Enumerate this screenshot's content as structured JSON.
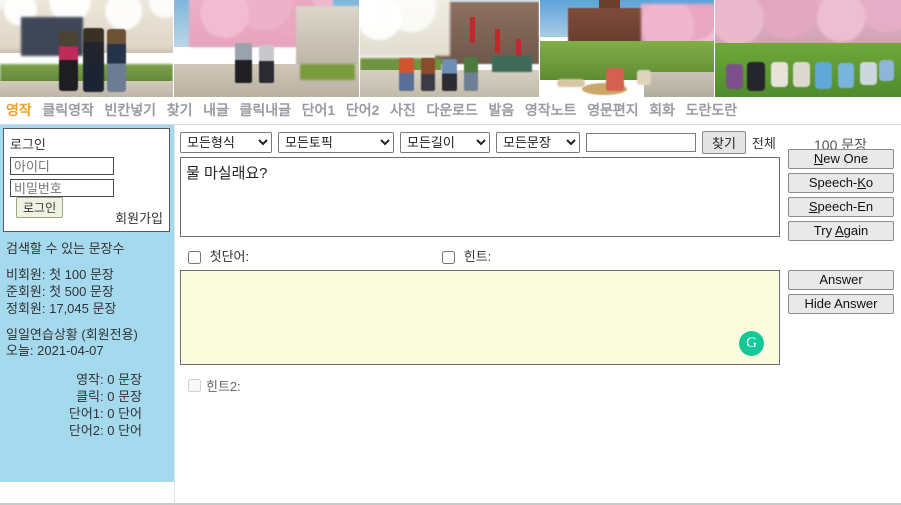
{
  "banner": {
    "alt": "campus spring photos banner",
    "panes": [
      "students-walking-blossom",
      "pink-blossom-street",
      "campus-red-banners",
      "brick-hall-lawn",
      "students-group-lawn"
    ]
  },
  "nav": {
    "items": [
      {
        "label": "영작",
        "active": true
      },
      {
        "label": "클릭영작",
        "active": false
      },
      {
        "label": "빈칸넣기",
        "active": false
      },
      {
        "label": "찾기",
        "active": false
      },
      {
        "label": "내글",
        "active": false
      },
      {
        "label": "클릭내글",
        "active": false
      },
      {
        "label": "단어1",
        "active": false
      },
      {
        "label": "단어2",
        "active": false
      },
      {
        "label": "사진",
        "active": false
      },
      {
        "label": "다운로드",
        "active": false
      },
      {
        "label": "발음",
        "active": false
      },
      {
        "label": "영작노트",
        "active": false
      },
      {
        "label": "영문편지",
        "active": false
      },
      {
        "label": "회화",
        "active": false
      },
      {
        "label": "도란도란",
        "active": false
      }
    ]
  },
  "sidebar": {
    "login": {
      "title": "로그인",
      "id_placeholder": "아이디",
      "pw_placeholder": "비밀번호",
      "login_button": "로그인",
      "signup_link": "회원가입"
    },
    "searchable": {
      "heading": "검색할 수 있는 문장수",
      "lines": [
        "비회원: 첫 100 문장",
        "준회원: 첫 500 문장",
        "정회원: 17,045 문장"
      ]
    },
    "practice": {
      "heading": "일일연습상황 (회원전용)",
      "today_label": "오늘: 2021-04-07",
      "stats": [
        "영작: 0 문장",
        "클릭: 0 문장",
        "단어1: 0 단어",
        "단어2: 0 단어"
      ]
    }
  },
  "filters": {
    "form_selected": "모든형식",
    "topic_selected": "모든토픽",
    "length_selected": "모든길이",
    "sentence_selected": "모든문장",
    "search_value": "",
    "search_placeholder": "",
    "find_button": "찾기",
    "all_label": "전체",
    "count_label": "100 문장"
  },
  "question": {
    "text": "물 마실래요?"
  },
  "options": {
    "first_word_label": "첫단어:",
    "hint_label": "힌트:",
    "hint2_label": "힌트2:",
    "first_word_checked": false,
    "hint_checked": false,
    "hint2_checked": false,
    "hint2_disabled": true
  },
  "answer": {
    "text": "",
    "grammar_icon": "G"
  },
  "buttons": {
    "new_one": {
      "pre": "",
      "key": "N",
      "post": "ew One"
    },
    "speech_ko": {
      "pre": "Speech-",
      "key": "K",
      "post": "o"
    },
    "speech_en": {
      "pre": "",
      "key": "S",
      "post": "peech-En"
    },
    "try_again": {
      "pre": "Try ",
      "key": "A",
      "post": "gain"
    },
    "answer": "Answer",
    "hide_answer": "Hide Answer"
  },
  "colors": {
    "nav_active": "#f0a030",
    "nav_inactive": "#9a9aa2",
    "sidebar_bg": "#a4d9ee",
    "answer_bg": "#fbfbdd",
    "grammar_green": "#16c79a"
  }
}
